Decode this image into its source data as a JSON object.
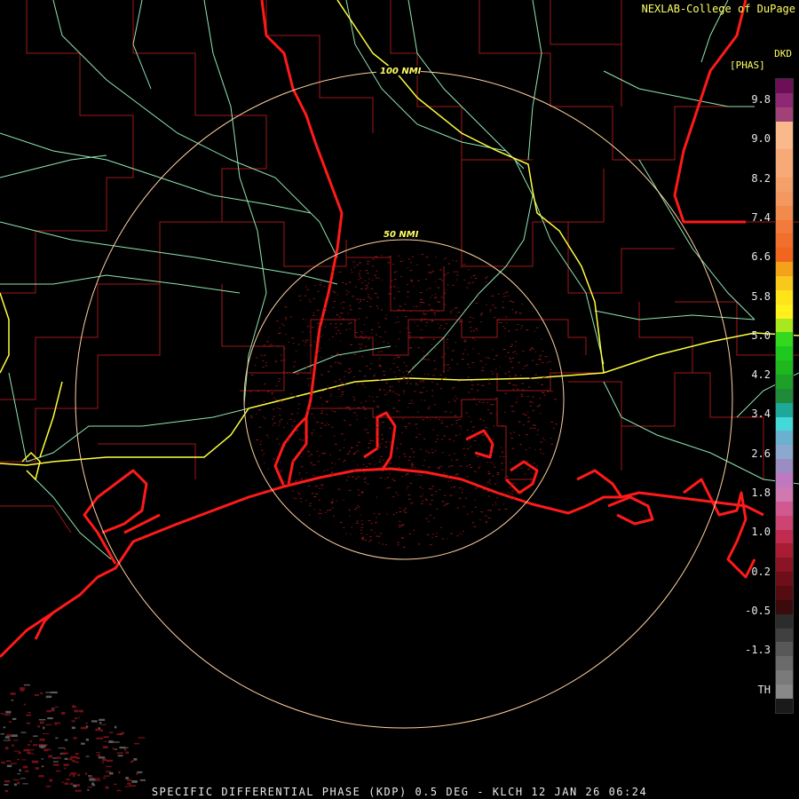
{
  "credit": "NEXLAB-College of DuPage",
  "product_line": "SPECIFIC DIFFERENTIAL PHASE (KDP) 0.5 DEG - KLCH 12 JAN 26 06:24",
  "range_rings": [
    {
      "label": "100 NMI"
    },
    {
      "label": "50 NMI"
    }
  ],
  "legend": {
    "variable": "DKD",
    "unit": "[PHAS]",
    "labels": [
      "9.8",
      "9.0",
      "8.2",
      "7.4",
      "6.6",
      "5.8",
      "5.0",
      "4.2",
      "3.4",
      "2.6",
      "1.8",
      "1.0",
      "0.2",
      "-0.5",
      "-1.3",
      "TH"
    ],
    "colors": [
      "#6d0f57",
      "#8e2873",
      "#a04278",
      "#f9b98a",
      "#f9b98a",
      "#f7aa78",
      "#f7aa78",
      "#f4a06a",
      "#f29860",
      "#f28a4c",
      "#f27a3a",
      "#f26e2c",
      "#f0661e",
      "#f4a21a",
      "#f8c81a",
      "#ffe41a",
      "#fff01e",
      "#a8e81e",
      "#34d81e",
      "#1ec81e",
      "#1eb81e",
      "#1ea028",
      "#1e8a3a",
      "#1ea89a",
      "#44d8d8",
      "#6cb0d0",
      "#8ca8cc",
      "#9c8cc4",
      "#c078c0",
      "#d078b0",
      "#d05a90",
      "#cc4474",
      "#c02c50",
      "#a81c34",
      "#8a1424",
      "#6e0e18",
      "#560a12",
      "#3a0a0c",
      "#2c2c2c",
      "#404040",
      "#585858",
      "#6a6a6a",
      "#7a7a7a",
      "#888888",
      "#1a1a1a"
    ],
    "palette": {
      "coast": "#ff1a1a",
      "county": "#a01818",
      "highway": "#90e6b0",
      "interstate": "#ffff40",
      "ring": "#ffd0a0"
    }
  }
}
